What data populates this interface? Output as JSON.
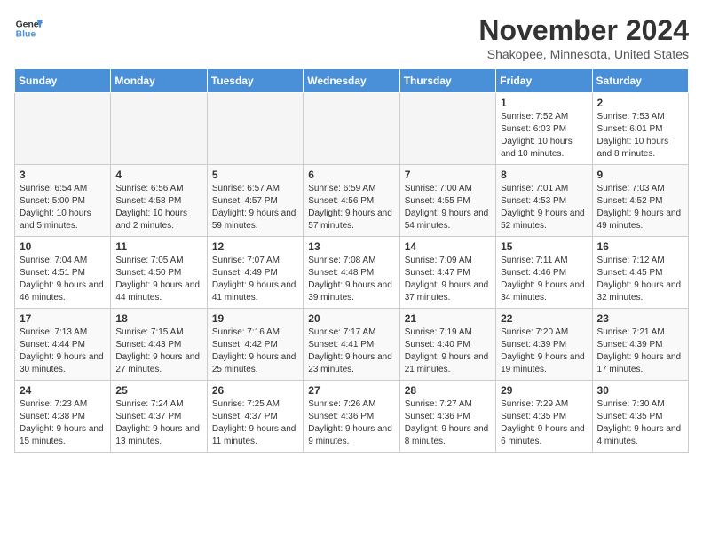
{
  "header": {
    "logo_line1": "General",
    "logo_line2": "Blue",
    "month_title": "November 2024",
    "location": "Shakopee, Minnesota, United States"
  },
  "days_of_week": [
    "Sunday",
    "Monday",
    "Tuesday",
    "Wednesday",
    "Thursday",
    "Friday",
    "Saturday"
  ],
  "weeks": [
    [
      {
        "day": "",
        "empty": true
      },
      {
        "day": "",
        "empty": true
      },
      {
        "day": "",
        "empty": true
      },
      {
        "day": "",
        "empty": true
      },
      {
        "day": "",
        "empty": true
      },
      {
        "day": "1",
        "sunrise": "Sunrise: 7:52 AM",
        "sunset": "Sunset: 6:03 PM",
        "daylight": "Daylight: 10 hours and 10 minutes."
      },
      {
        "day": "2",
        "sunrise": "Sunrise: 7:53 AM",
        "sunset": "Sunset: 6:01 PM",
        "daylight": "Daylight: 10 hours and 8 minutes."
      }
    ],
    [
      {
        "day": "3",
        "sunrise": "Sunrise: 6:54 AM",
        "sunset": "Sunset: 5:00 PM",
        "daylight": "Daylight: 10 hours and 5 minutes."
      },
      {
        "day": "4",
        "sunrise": "Sunrise: 6:56 AM",
        "sunset": "Sunset: 4:58 PM",
        "daylight": "Daylight: 10 hours and 2 minutes."
      },
      {
        "day": "5",
        "sunrise": "Sunrise: 6:57 AM",
        "sunset": "Sunset: 4:57 PM",
        "daylight": "Daylight: 9 hours and 59 minutes."
      },
      {
        "day": "6",
        "sunrise": "Sunrise: 6:59 AM",
        "sunset": "Sunset: 4:56 PM",
        "daylight": "Daylight: 9 hours and 57 minutes."
      },
      {
        "day": "7",
        "sunrise": "Sunrise: 7:00 AM",
        "sunset": "Sunset: 4:55 PM",
        "daylight": "Daylight: 9 hours and 54 minutes."
      },
      {
        "day": "8",
        "sunrise": "Sunrise: 7:01 AM",
        "sunset": "Sunset: 4:53 PM",
        "daylight": "Daylight: 9 hours and 52 minutes."
      },
      {
        "day": "9",
        "sunrise": "Sunrise: 7:03 AM",
        "sunset": "Sunset: 4:52 PM",
        "daylight": "Daylight: 9 hours and 49 minutes."
      }
    ],
    [
      {
        "day": "10",
        "sunrise": "Sunrise: 7:04 AM",
        "sunset": "Sunset: 4:51 PM",
        "daylight": "Daylight: 9 hours and 46 minutes."
      },
      {
        "day": "11",
        "sunrise": "Sunrise: 7:05 AM",
        "sunset": "Sunset: 4:50 PM",
        "daylight": "Daylight: 9 hours and 44 minutes."
      },
      {
        "day": "12",
        "sunrise": "Sunrise: 7:07 AM",
        "sunset": "Sunset: 4:49 PM",
        "daylight": "Daylight: 9 hours and 41 minutes."
      },
      {
        "day": "13",
        "sunrise": "Sunrise: 7:08 AM",
        "sunset": "Sunset: 4:48 PM",
        "daylight": "Daylight: 9 hours and 39 minutes."
      },
      {
        "day": "14",
        "sunrise": "Sunrise: 7:09 AM",
        "sunset": "Sunset: 4:47 PM",
        "daylight": "Daylight: 9 hours and 37 minutes."
      },
      {
        "day": "15",
        "sunrise": "Sunrise: 7:11 AM",
        "sunset": "Sunset: 4:46 PM",
        "daylight": "Daylight: 9 hours and 34 minutes."
      },
      {
        "day": "16",
        "sunrise": "Sunrise: 7:12 AM",
        "sunset": "Sunset: 4:45 PM",
        "daylight": "Daylight: 9 hours and 32 minutes."
      }
    ],
    [
      {
        "day": "17",
        "sunrise": "Sunrise: 7:13 AM",
        "sunset": "Sunset: 4:44 PM",
        "daylight": "Daylight: 9 hours and 30 minutes."
      },
      {
        "day": "18",
        "sunrise": "Sunrise: 7:15 AM",
        "sunset": "Sunset: 4:43 PM",
        "daylight": "Daylight: 9 hours and 27 minutes."
      },
      {
        "day": "19",
        "sunrise": "Sunrise: 7:16 AM",
        "sunset": "Sunset: 4:42 PM",
        "daylight": "Daylight: 9 hours and 25 minutes."
      },
      {
        "day": "20",
        "sunrise": "Sunrise: 7:17 AM",
        "sunset": "Sunset: 4:41 PM",
        "daylight": "Daylight: 9 hours and 23 minutes."
      },
      {
        "day": "21",
        "sunrise": "Sunrise: 7:19 AM",
        "sunset": "Sunset: 4:40 PM",
        "daylight": "Daylight: 9 hours and 21 minutes."
      },
      {
        "day": "22",
        "sunrise": "Sunrise: 7:20 AM",
        "sunset": "Sunset: 4:39 PM",
        "daylight": "Daylight: 9 hours and 19 minutes."
      },
      {
        "day": "23",
        "sunrise": "Sunrise: 7:21 AM",
        "sunset": "Sunset: 4:39 PM",
        "daylight": "Daylight: 9 hours and 17 minutes."
      }
    ],
    [
      {
        "day": "24",
        "sunrise": "Sunrise: 7:23 AM",
        "sunset": "Sunset: 4:38 PM",
        "daylight": "Daylight: 9 hours and 15 minutes."
      },
      {
        "day": "25",
        "sunrise": "Sunrise: 7:24 AM",
        "sunset": "Sunset: 4:37 PM",
        "daylight": "Daylight: 9 hours and 13 minutes."
      },
      {
        "day": "26",
        "sunrise": "Sunrise: 7:25 AM",
        "sunset": "Sunset: 4:37 PM",
        "daylight": "Daylight: 9 hours and 11 minutes."
      },
      {
        "day": "27",
        "sunrise": "Sunrise: 7:26 AM",
        "sunset": "Sunset: 4:36 PM",
        "daylight": "Daylight: 9 hours and 9 minutes."
      },
      {
        "day": "28",
        "sunrise": "Sunrise: 7:27 AM",
        "sunset": "Sunset: 4:36 PM",
        "daylight": "Daylight: 9 hours and 8 minutes."
      },
      {
        "day": "29",
        "sunrise": "Sunrise: 7:29 AM",
        "sunset": "Sunset: 4:35 PM",
        "daylight": "Daylight: 9 hours and 6 minutes."
      },
      {
        "day": "30",
        "sunrise": "Sunrise: 7:30 AM",
        "sunset": "Sunset: 4:35 PM",
        "daylight": "Daylight: 9 hours and 4 minutes."
      }
    ]
  ]
}
